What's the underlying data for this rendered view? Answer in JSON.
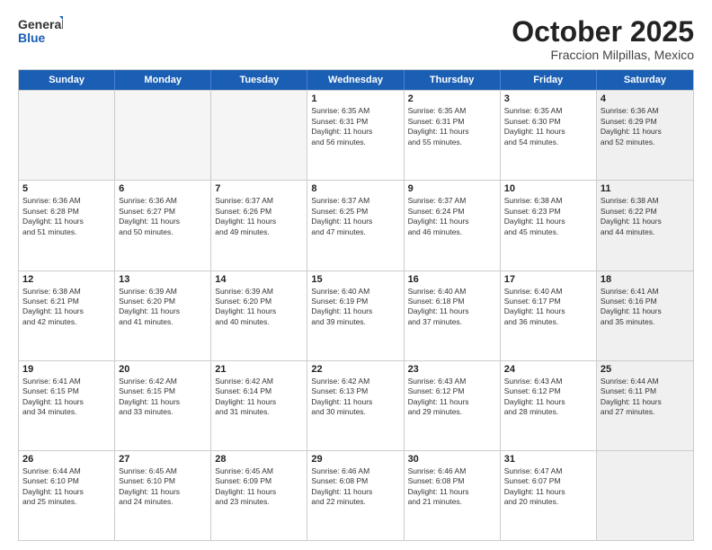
{
  "logo": {
    "general": "General",
    "blue": "Blue"
  },
  "title": "October 2025",
  "subtitle": "Fraccion Milpillas, Mexico",
  "days": [
    "Sunday",
    "Monday",
    "Tuesday",
    "Wednesday",
    "Thursday",
    "Friday",
    "Saturday"
  ],
  "rows": [
    [
      {
        "day": "",
        "empty": true
      },
      {
        "day": "",
        "empty": true
      },
      {
        "day": "",
        "empty": true
      },
      {
        "day": "1",
        "line1": "Sunrise: 6:35 AM",
        "line2": "Sunset: 6:31 PM",
        "line3": "Daylight: 11 hours",
        "line4": "and 56 minutes."
      },
      {
        "day": "2",
        "line1": "Sunrise: 6:35 AM",
        "line2": "Sunset: 6:31 PM",
        "line3": "Daylight: 11 hours",
        "line4": "and 55 minutes."
      },
      {
        "day": "3",
        "line1": "Sunrise: 6:35 AM",
        "line2": "Sunset: 6:30 PM",
        "line3": "Daylight: 11 hours",
        "line4": "and 54 minutes."
      },
      {
        "day": "4",
        "line1": "Sunrise: 6:36 AM",
        "line2": "Sunset: 6:29 PM",
        "line3": "Daylight: 11 hours",
        "line4": "and 52 minutes.",
        "shaded": true
      }
    ],
    [
      {
        "day": "5",
        "line1": "Sunrise: 6:36 AM",
        "line2": "Sunset: 6:28 PM",
        "line3": "Daylight: 11 hours",
        "line4": "and 51 minutes."
      },
      {
        "day": "6",
        "line1": "Sunrise: 6:36 AM",
        "line2": "Sunset: 6:27 PM",
        "line3": "Daylight: 11 hours",
        "line4": "and 50 minutes."
      },
      {
        "day": "7",
        "line1": "Sunrise: 6:37 AM",
        "line2": "Sunset: 6:26 PM",
        "line3": "Daylight: 11 hours",
        "line4": "and 49 minutes."
      },
      {
        "day": "8",
        "line1": "Sunrise: 6:37 AM",
        "line2": "Sunset: 6:25 PM",
        "line3": "Daylight: 11 hours",
        "line4": "and 47 minutes."
      },
      {
        "day": "9",
        "line1": "Sunrise: 6:37 AM",
        "line2": "Sunset: 6:24 PM",
        "line3": "Daylight: 11 hours",
        "line4": "and 46 minutes."
      },
      {
        "day": "10",
        "line1": "Sunrise: 6:38 AM",
        "line2": "Sunset: 6:23 PM",
        "line3": "Daylight: 11 hours",
        "line4": "and 45 minutes."
      },
      {
        "day": "11",
        "line1": "Sunrise: 6:38 AM",
        "line2": "Sunset: 6:22 PM",
        "line3": "Daylight: 11 hours",
        "line4": "and 44 minutes.",
        "shaded": true
      }
    ],
    [
      {
        "day": "12",
        "line1": "Sunrise: 6:38 AM",
        "line2": "Sunset: 6:21 PM",
        "line3": "Daylight: 11 hours",
        "line4": "and 42 minutes."
      },
      {
        "day": "13",
        "line1": "Sunrise: 6:39 AM",
        "line2": "Sunset: 6:20 PM",
        "line3": "Daylight: 11 hours",
        "line4": "and 41 minutes."
      },
      {
        "day": "14",
        "line1": "Sunrise: 6:39 AM",
        "line2": "Sunset: 6:20 PM",
        "line3": "Daylight: 11 hours",
        "line4": "and 40 minutes."
      },
      {
        "day": "15",
        "line1": "Sunrise: 6:40 AM",
        "line2": "Sunset: 6:19 PM",
        "line3": "Daylight: 11 hours",
        "line4": "and 39 minutes."
      },
      {
        "day": "16",
        "line1": "Sunrise: 6:40 AM",
        "line2": "Sunset: 6:18 PM",
        "line3": "Daylight: 11 hours",
        "line4": "and 37 minutes."
      },
      {
        "day": "17",
        "line1": "Sunrise: 6:40 AM",
        "line2": "Sunset: 6:17 PM",
        "line3": "Daylight: 11 hours",
        "line4": "and 36 minutes."
      },
      {
        "day": "18",
        "line1": "Sunrise: 6:41 AM",
        "line2": "Sunset: 6:16 PM",
        "line3": "Daylight: 11 hours",
        "line4": "and 35 minutes.",
        "shaded": true
      }
    ],
    [
      {
        "day": "19",
        "line1": "Sunrise: 6:41 AM",
        "line2": "Sunset: 6:15 PM",
        "line3": "Daylight: 11 hours",
        "line4": "and 34 minutes."
      },
      {
        "day": "20",
        "line1": "Sunrise: 6:42 AM",
        "line2": "Sunset: 6:15 PM",
        "line3": "Daylight: 11 hours",
        "line4": "and 33 minutes."
      },
      {
        "day": "21",
        "line1": "Sunrise: 6:42 AM",
        "line2": "Sunset: 6:14 PM",
        "line3": "Daylight: 11 hours",
        "line4": "and 31 minutes."
      },
      {
        "day": "22",
        "line1": "Sunrise: 6:42 AM",
        "line2": "Sunset: 6:13 PM",
        "line3": "Daylight: 11 hours",
        "line4": "and 30 minutes."
      },
      {
        "day": "23",
        "line1": "Sunrise: 6:43 AM",
        "line2": "Sunset: 6:12 PM",
        "line3": "Daylight: 11 hours",
        "line4": "and 29 minutes."
      },
      {
        "day": "24",
        "line1": "Sunrise: 6:43 AM",
        "line2": "Sunset: 6:12 PM",
        "line3": "Daylight: 11 hours",
        "line4": "and 28 minutes."
      },
      {
        "day": "25",
        "line1": "Sunrise: 6:44 AM",
        "line2": "Sunset: 6:11 PM",
        "line3": "Daylight: 11 hours",
        "line4": "and 27 minutes.",
        "shaded": true
      }
    ],
    [
      {
        "day": "26",
        "line1": "Sunrise: 6:44 AM",
        "line2": "Sunset: 6:10 PM",
        "line3": "Daylight: 11 hours",
        "line4": "and 25 minutes."
      },
      {
        "day": "27",
        "line1": "Sunrise: 6:45 AM",
        "line2": "Sunset: 6:10 PM",
        "line3": "Daylight: 11 hours",
        "line4": "and 24 minutes."
      },
      {
        "day": "28",
        "line1": "Sunrise: 6:45 AM",
        "line2": "Sunset: 6:09 PM",
        "line3": "Daylight: 11 hours",
        "line4": "and 23 minutes."
      },
      {
        "day": "29",
        "line1": "Sunrise: 6:46 AM",
        "line2": "Sunset: 6:08 PM",
        "line3": "Daylight: 11 hours",
        "line4": "and 22 minutes."
      },
      {
        "day": "30",
        "line1": "Sunrise: 6:46 AM",
        "line2": "Sunset: 6:08 PM",
        "line3": "Daylight: 11 hours",
        "line4": "and 21 minutes."
      },
      {
        "day": "31",
        "line1": "Sunrise: 6:47 AM",
        "line2": "Sunset: 6:07 PM",
        "line3": "Daylight: 11 hours",
        "line4": "and 20 minutes."
      },
      {
        "day": "",
        "empty": true,
        "shaded": true
      }
    ]
  ]
}
